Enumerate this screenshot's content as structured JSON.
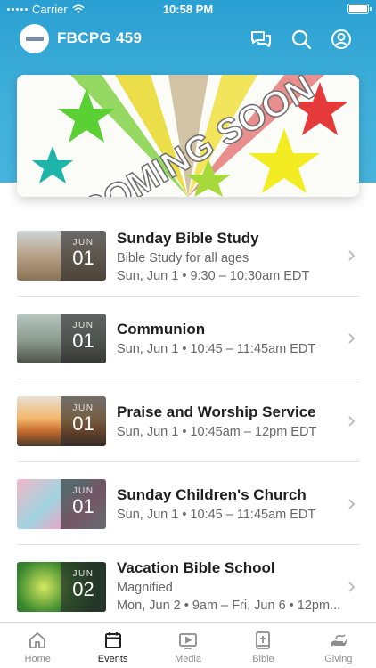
{
  "status_bar": {
    "carrier": "Carrier",
    "time": "10:58 PM"
  },
  "app": {
    "title": "FBCPG 459",
    "icons": [
      "chat-icon",
      "search-icon",
      "profile-icon"
    ]
  },
  "banner": {
    "text": "COMING SOON"
  },
  "events": [
    {
      "title": "Sunday Bible Study",
      "subtitle": "Bible Study for all ages",
      "time": "Sun, Jun 1 • 9:30 – 10:30am EDT",
      "month": "JUN",
      "day": "01"
    },
    {
      "title": "Communion",
      "subtitle": "",
      "time": "Sun, Jun 1 • 10:45 – 11:45am EDT",
      "month": "JUN",
      "day": "01"
    },
    {
      "title": "Praise and Worship Service",
      "subtitle": "",
      "time": "Sun, Jun 1 • 10:45am – 12pm EDT",
      "month": "JUN",
      "day": "01"
    },
    {
      "title": "Sunday Children's Church",
      "subtitle": "",
      "time": "Sun, Jun 1 • 10:45 – 11:45am EDT",
      "month": "JUN",
      "day": "01"
    },
    {
      "title": "Vacation Bible School",
      "subtitle": "Magnified",
      "time": "Mon, Jun 2 • 9am – Fri, Jun 6 • 12pm...",
      "month": "JUN",
      "day": "02"
    }
  ],
  "tabs": [
    {
      "label": "Home",
      "icon": "home-icon"
    },
    {
      "label": "Events",
      "icon": "calendar-icon",
      "active": true
    },
    {
      "label": "Media",
      "icon": "media-icon"
    },
    {
      "label": "Bible",
      "icon": "bible-icon"
    },
    {
      "label": "Giving",
      "icon": "giving-icon"
    }
  ],
  "colors": {
    "header": "#2a9fd2",
    "active_tab": "#222222",
    "inactive_tab": "#8c8c8c"
  }
}
